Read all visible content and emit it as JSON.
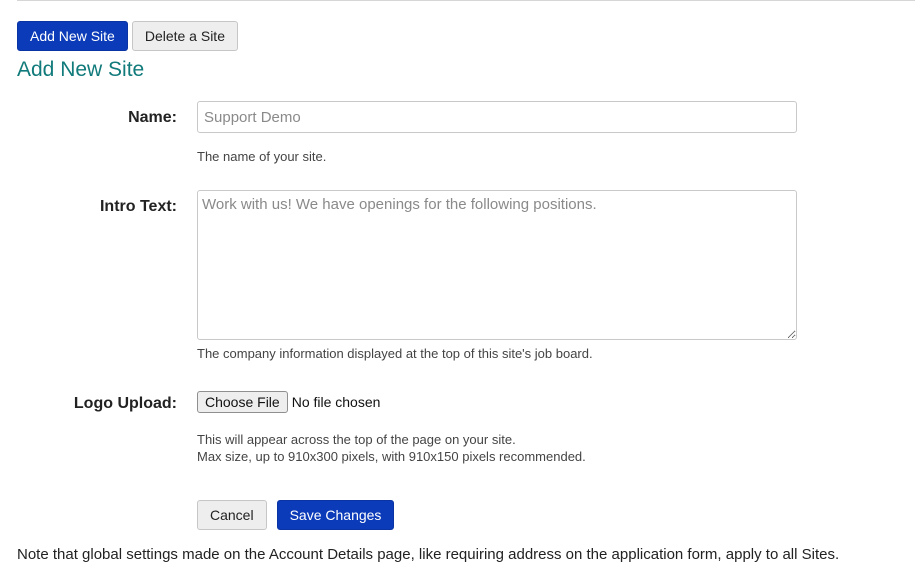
{
  "toolbar": {
    "add_label": "Add New Site",
    "delete_label": "Delete a Site"
  },
  "page_title": "Add New Site",
  "form": {
    "name": {
      "label": "Name:",
      "placeholder": "Support Demo",
      "value": "",
      "help": "The name of your site."
    },
    "intro": {
      "label": "Intro Text:",
      "placeholder": "Work with us! We have openings for the following positions.",
      "value": "",
      "help": "The company information displayed at the top of this site's job board."
    },
    "logo": {
      "label": "Logo Upload:",
      "button_label": "Choose File",
      "status": "No file chosen",
      "help_line1": "This will appear across the top of the page on your site.",
      "help_line2": "Max size, up to 910x300 pixels, with 910x150 pixels recommended."
    },
    "actions": {
      "cancel_label": "Cancel",
      "save_label": "Save Changes"
    }
  },
  "footnote": "Note that global settings made on the Account Details page, like requiring address on the application form, apply to all Sites.",
  "colors": {
    "primary": "#0b3bb8",
    "title": "#117a7a"
  }
}
